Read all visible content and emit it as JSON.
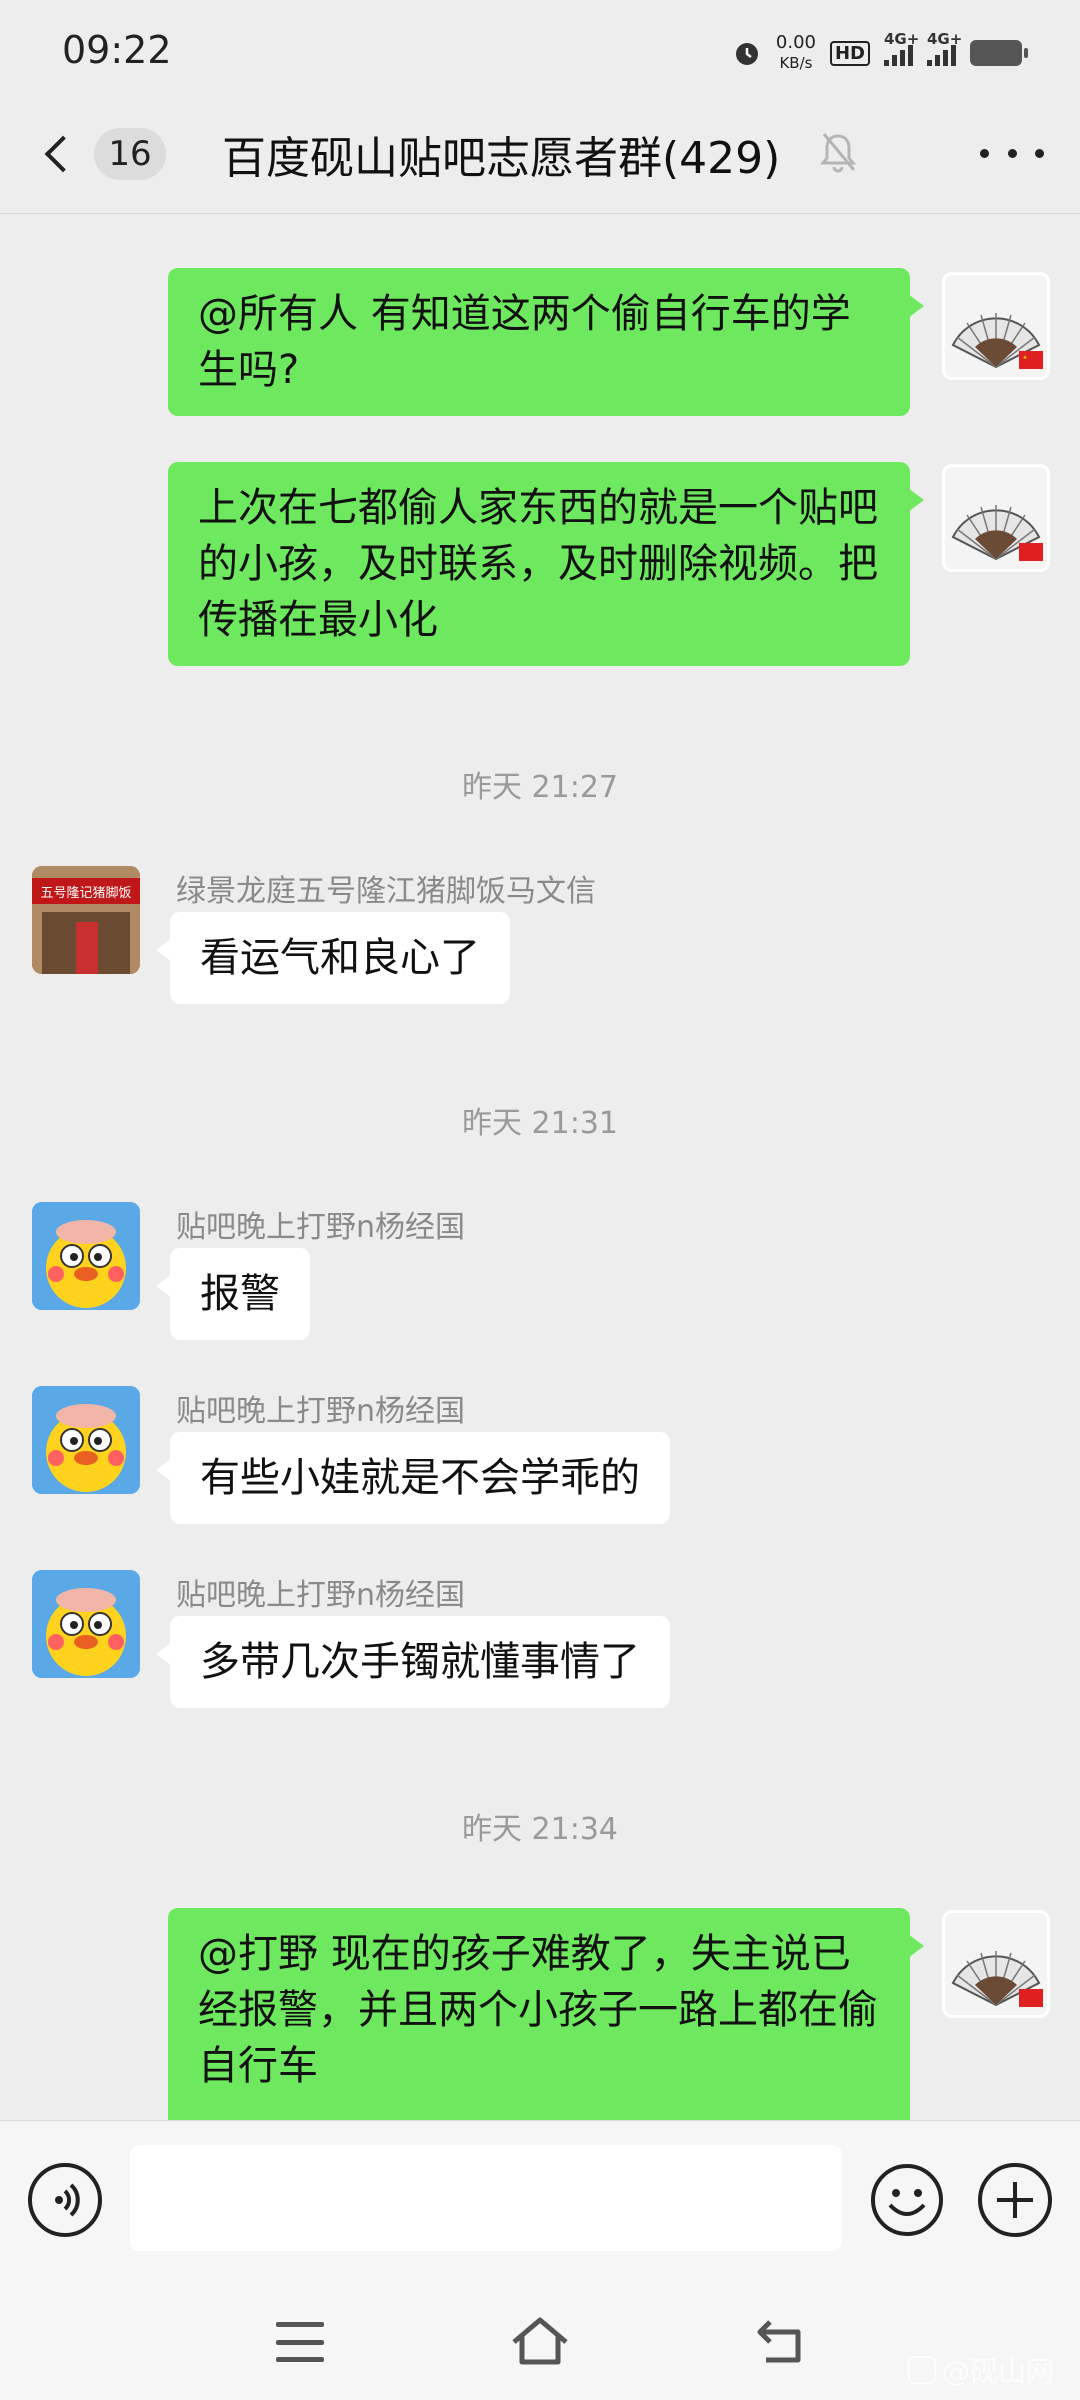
{
  "status_bar": {
    "time": "09:22",
    "net_speed_value": "0.00",
    "net_speed_unit": "KB/s",
    "hd_badge": "HD",
    "sim1": "4G+",
    "sim2": "4G+"
  },
  "header": {
    "unread_count": "16",
    "title": "百度砚山贴吧志愿者群(429)"
  },
  "messages": {
    "m1": {
      "text": "@所有人  有知道这两个偷自行车的学生吗?"
    },
    "m2": {
      "text": "上次在七都偷人家东西的就是一个贴吧的小孩，及时联系，及时删除视频。把传播在最小化"
    },
    "ts1": "昨天 21:27",
    "m3": {
      "sender": "绿景龙庭五号隆江猪脚饭马文信",
      "text": "看运气和良心了",
      "avatar_sign": "五号隆记猪脚饭"
    },
    "ts2": "昨天 21:31",
    "m4": {
      "sender": "贴吧晚上打野n杨经国",
      "text": "报警"
    },
    "m5": {
      "sender": "贴吧晚上打野n杨经国",
      "text": "有些小娃就是不会学乖的"
    },
    "m6": {
      "sender": "贴吧晚上打野n杨经国",
      "text": "多带几次手镯就懂事情了"
    },
    "ts3": "昨天 21:34",
    "m7": {
      "text": "@打野  现在的孩子难教了，失主说已经报警，并且两个小孩子一路上都在偷自行车"
    }
  },
  "input": {
    "value": ""
  },
  "watermark": "@砚山网",
  "colors": {
    "bubble_green": "#6ee85e",
    "bubble_white": "#ffffff",
    "background": "#ededed"
  },
  "icons": [
    "back-chevron-icon",
    "mute-bell-icon",
    "more-dots-icon",
    "voice-icon",
    "emoji-icon",
    "plus-icon",
    "menu-icon",
    "home-icon",
    "back-nav-icon"
  ]
}
